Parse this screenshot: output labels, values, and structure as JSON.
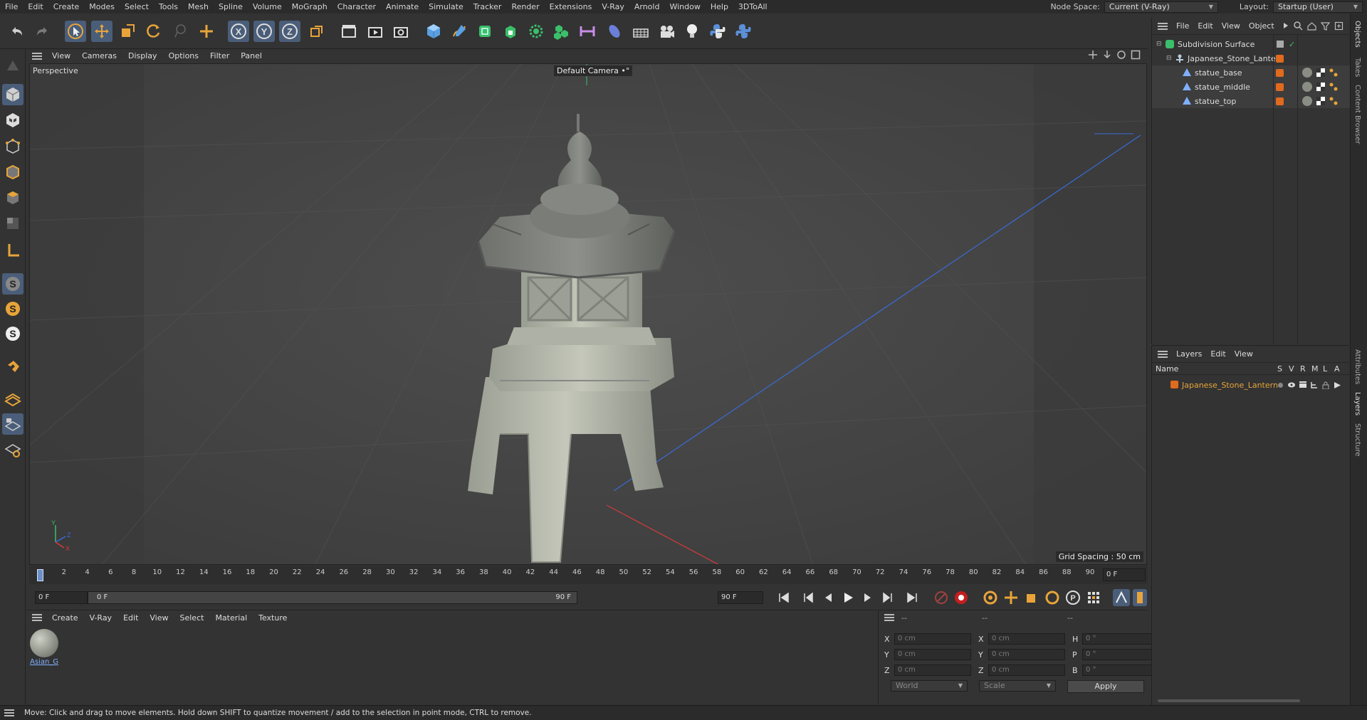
{
  "menubar": {
    "items": [
      "File",
      "Edit",
      "Create",
      "Modes",
      "Select",
      "Tools",
      "Mesh",
      "Spline",
      "Volume",
      "MoGraph",
      "Character",
      "Animate",
      "Simulate",
      "Tracker",
      "Render",
      "Extensions",
      "V-Ray",
      "Arnold",
      "Window",
      "Help",
      "3DToAll"
    ],
    "node_space_label": "Node Space:",
    "node_space_value": "Current (V-Ray)",
    "layout_label": "Layout:",
    "layout_value": "Startup (User)"
  },
  "viewport": {
    "menu": [
      "View",
      "Cameras",
      "Display",
      "Options",
      "Filter",
      "Panel"
    ],
    "label": "Perspective",
    "camera": "Default Camera",
    "grid_spacing": "Grid Spacing : 50 cm"
  },
  "timeline": {
    "ticks": [
      "0",
      "2",
      "4",
      "6",
      "8",
      "10",
      "12",
      "14",
      "16",
      "18",
      "20",
      "22",
      "24",
      "26",
      "28",
      "30",
      "32",
      "34",
      "36",
      "38",
      "40",
      "42",
      "44",
      "46",
      "48",
      "50",
      "52",
      "54",
      "56",
      "58",
      "60",
      "62",
      "64",
      "66",
      "68",
      "70",
      "72",
      "74",
      "76",
      "78",
      "80",
      "82",
      "84",
      "86",
      "88",
      "90"
    ],
    "current_frame_right": "0 F",
    "start_field": "0 F",
    "range_start": "0 F",
    "range_end": "90 F",
    "end_field": "90 F"
  },
  "materials": {
    "menu": [
      "Create",
      "V-Ray",
      "Edit",
      "View",
      "Select",
      "Material",
      "Texture"
    ],
    "items": [
      {
        "name": "Asian_G"
      }
    ]
  },
  "coords": {
    "headers": [
      "--",
      "--",
      "--"
    ],
    "rows": [
      {
        "a1": "X",
        "v1": "0 cm",
        "a2": "X",
        "v2": "0 cm",
        "a3": "H",
        "v3": "0 °"
      },
      {
        "a1": "Y",
        "v1": "0 cm",
        "a2": "Y",
        "v2": "0 cm",
        "a3": "P",
        "v3": "0 °"
      },
      {
        "a1": "Z",
        "v1": "0 cm",
        "a2": "Z",
        "v2": "0 cm",
        "a3": "B",
        "v3": "0 °"
      }
    ],
    "world": "World",
    "scale": "Scale",
    "apply": "Apply"
  },
  "objects": {
    "menu": [
      "File",
      "Edit",
      "View",
      "Object"
    ],
    "tree": [
      {
        "name": "Subdivision Surface",
        "indent": 0
      },
      {
        "name": "Japanese_Stone_Lantern",
        "indent": 1
      },
      {
        "name": "statue_base",
        "indent": 2
      },
      {
        "name": "statue_middle",
        "indent": 2
      },
      {
        "name": "statue_top",
        "indent": 2
      }
    ]
  },
  "layers": {
    "menu": [
      "Layers",
      "Edit",
      "View"
    ],
    "header_name": "Name",
    "header_flags": [
      "S",
      "V",
      "R",
      "M",
      "L",
      "A"
    ],
    "items": [
      {
        "name": "Japanese_Stone_Lantern"
      }
    ]
  },
  "sidetabs": [
    "Objects",
    "Takes",
    "Content Browser",
    "Attributes",
    "Layers",
    "Structure"
  ],
  "status": "Move: Click and drag to move elements. Hold down SHIFT to quantize movement / add to the selection in point mode, CTRL to remove.",
  "colors": {
    "accent": "#e06a1e",
    "selected_blue": "#3a6fd8",
    "axis_x": "#d53b3b",
    "axis_z": "#3a6bd8"
  }
}
